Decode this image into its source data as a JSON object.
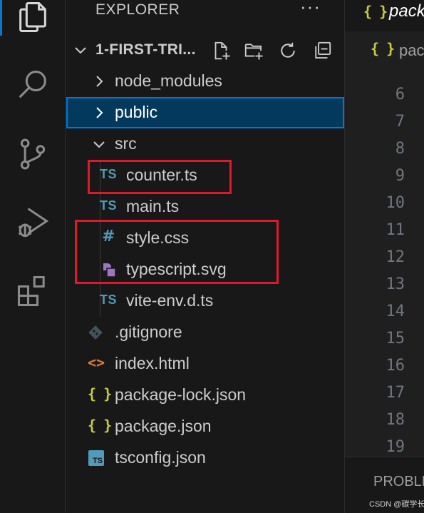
{
  "sidebar": {
    "title": "EXPLORER",
    "more_label": "···",
    "project_name": "1-FIRST-TRI...",
    "tree": {
      "node_modules": "node_modules",
      "public": "public",
      "src": "src",
      "counter": "counter.ts",
      "main": "main.ts",
      "style": "style.css",
      "typescript_svg": "typescript.svg",
      "vite_env": "vite-env.d.ts",
      "gitignore": ".gitignore",
      "index_html": "index.html",
      "package_lock": "package-lock.json",
      "package_json": "package.json",
      "tsconfig": "tsconfig.json"
    },
    "badges": {
      "ts": "TS",
      "hash": "#",
      "braces": "{ }",
      "html": "<>",
      "tsconfig_badge": "TS"
    }
  },
  "editor": {
    "tab_label": "pack",
    "breadcrumb_label": "pac",
    "line_numbers": [
      "6",
      "7",
      "8",
      "9",
      "10",
      "11",
      "12",
      "13",
      "14",
      "15",
      "16",
      "17",
      "18",
      "19"
    ],
    "braces_icon": "{ }"
  },
  "panel": {
    "tab_label": "PROBLE"
  },
  "watermark": "CSDN @碳学长",
  "colors": {
    "selection_bg": "#04395e",
    "focus_border": "#0078d4",
    "highlight_box": "#e0182a",
    "ts_blue": "#519aba",
    "json_yellow": "#cbcb41",
    "html_orange": "#e37933",
    "svg_purple": "#a074c4"
  }
}
